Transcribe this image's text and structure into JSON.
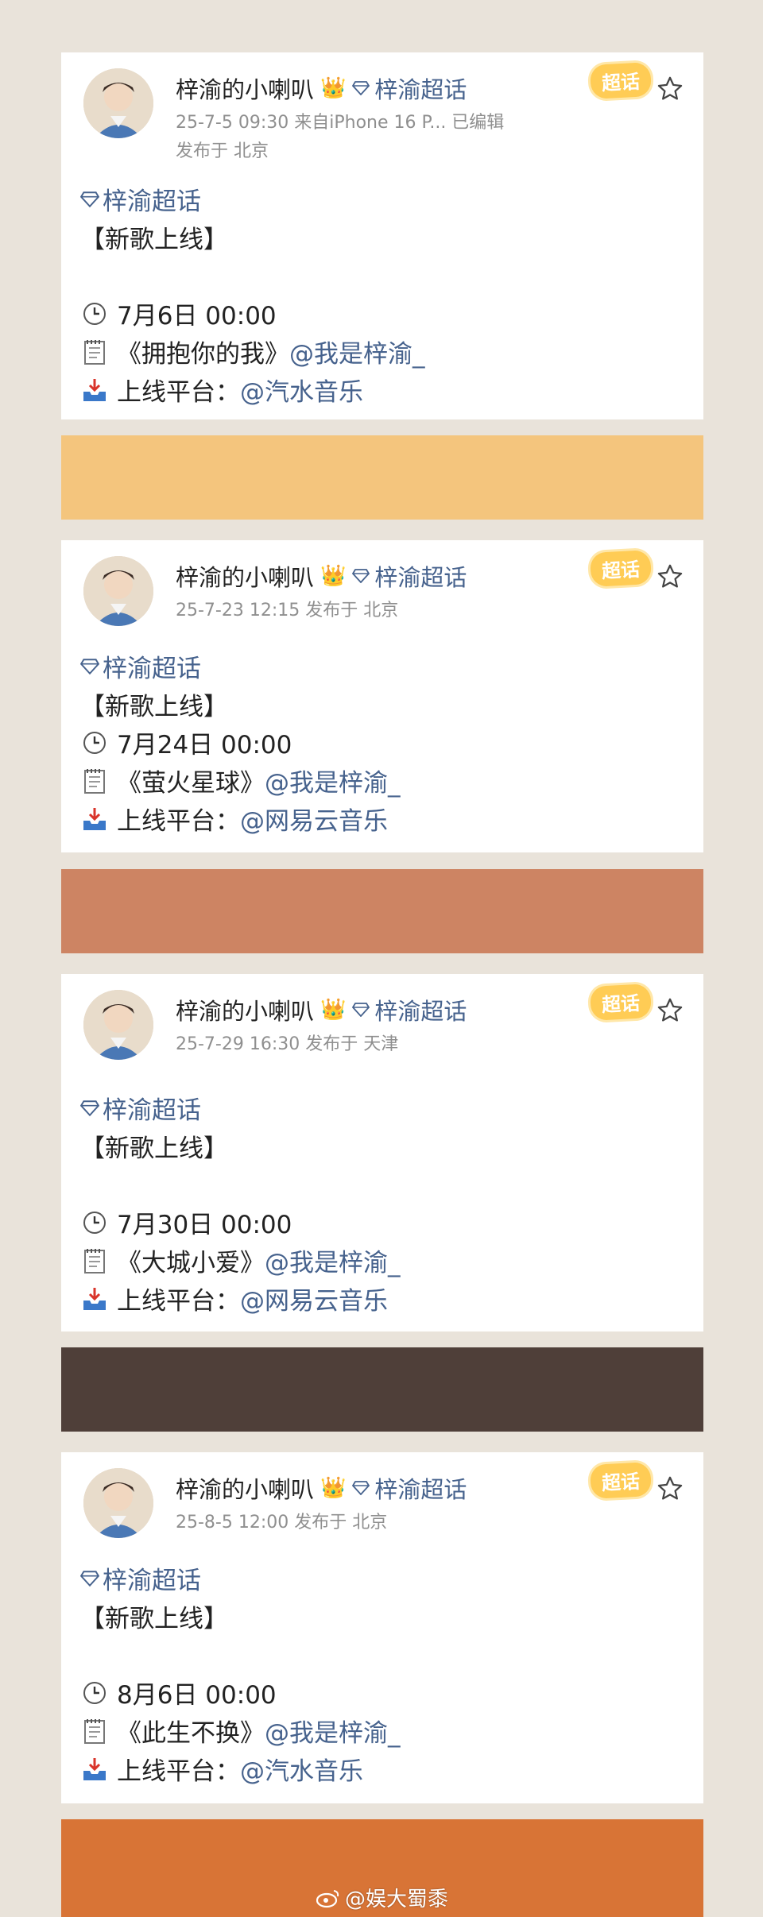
{
  "posts": [
    {
      "author": "梓渝的小喇叭",
      "topic_mini": "梓渝超话",
      "meta_line1": "25-7-5 09:30  来自iPhone 16 P...  已编辑",
      "meta_line2": "发布于 北京",
      "topic": "梓渝超话",
      "headline": "【新歌上线】",
      "time": "7月6日 00:00",
      "song": "《拥抱你的我》",
      "song_mention": "@我是梓渝_",
      "platform_label": "上线平台：",
      "platform_mention": "@汽水音乐",
      "badge": "超话"
    },
    {
      "author": "梓渝的小喇叭",
      "topic_mini": "梓渝超话",
      "meta_line1": "25-7-23 12:15  发布于 北京",
      "meta_line2": "",
      "topic": "梓渝超话",
      "headline": "【新歌上线】",
      "time": "7月24日 00:00",
      "song": "《萤火星球》",
      "song_mention": "@我是梓渝_",
      "platform_label": "上线平台：",
      "platform_mention": "@网易云音乐",
      "badge": "超话"
    },
    {
      "author": "梓渝的小喇叭",
      "topic_mini": "梓渝超话",
      "meta_line1": "25-7-29 16:30  发布于 天津",
      "meta_line2": "",
      "topic": "梓渝超话",
      "headline": "【新歌上线】",
      "time": "7月30日 00:00",
      "song": "《大城小爱》",
      "song_mention": "@我是梓渝_",
      "platform_label": "上线平台：",
      "platform_mention": "@网易云音乐",
      "badge": "超话"
    },
    {
      "author": "梓渝的小喇叭",
      "topic_mini": "梓渝超话",
      "meta_line1": "25-8-5 12:00  发布于 北京",
      "meta_line2": "",
      "topic": "梓渝超话",
      "headline": "【新歌上线】",
      "time": "8月6日 00:00",
      "song": "《此生不换》",
      "song_mention": "@我是梓渝_",
      "platform_label": "上线平台：",
      "platform_mention": "@汽水音乐",
      "badge": "超话"
    }
  ],
  "colors": {
    "background": "#e9e3da",
    "bar1": "#f4c57d",
    "bar2": "#cd8463",
    "bar3": "#4f3f39",
    "bar4": "#d87436",
    "link": "#46628d"
  },
  "watermark": "@娱大蜀黍"
}
